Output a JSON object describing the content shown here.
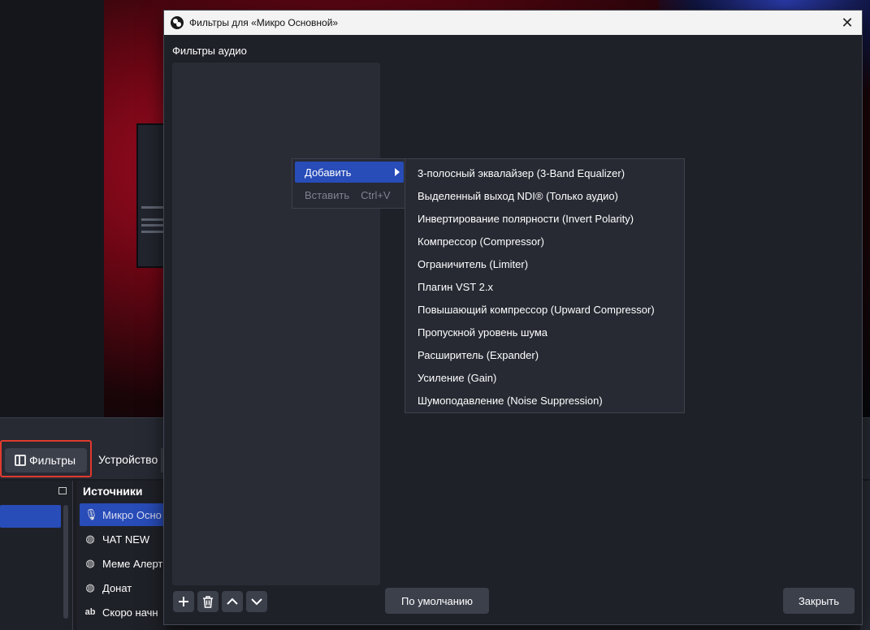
{
  "background": {
    "toolbar": {
      "filters_label": "Фильтры",
      "device_label": "Устройство"
    },
    "sources": {
      "header": "Источники",
      "items": [
        {
          "icon": "microphone-icon",
          "label": "Микро Осно"
        },
        {
          "icon": "globe-icon",
          "label": "ЧАТ NEW"
        },
        {
          "icon": "globe-icon",
          "label": "Меме Алерт"
        },
        {
          "icon": "globe-icon",
          "label": "Донат"
        },
        {
          "icon": "text-icon",
          "label": "Скоро начн"
        }
      ]
    }
  },
  "dialog": {
    "title": "Фильтры для «Микро Основной»",
    "section_label": "Фильтры аудио",
    "buttons": {
      "defaults": "По умолчанию",
      "close": "Закрыть"
    }
  },
  "context_menu": {
    "add_label": "Добавить",
    "paste_label": "Вставить",
    "paste_shortcut": "Ctrl+V"
  },
  "submenu": {
    "items": [
      "3-полосный эквалайзер (3-Band Equalizer)",
      "Выделенный выход NDI® (Только аудио)",
      "Инвертирование полярности (Invert Polarity)",
      "Компрессор (Compressor)",
      "Ограничитель (Limiter)",
      "Плагин VST 2.x",
      "Повышающий компрессор (Upward Compressor)",
      "Пропускной уровень шума",
      "Расширитель (Expander)",
      "Усиление (Gain)",
      "Шумоподавление (Noise Suppression)"
    ]
  },
  "colors": {
    "accent": "#284cb8",
    "highlight_border": "#e03a2e",
    "panel": "#292c35"
  }
}
